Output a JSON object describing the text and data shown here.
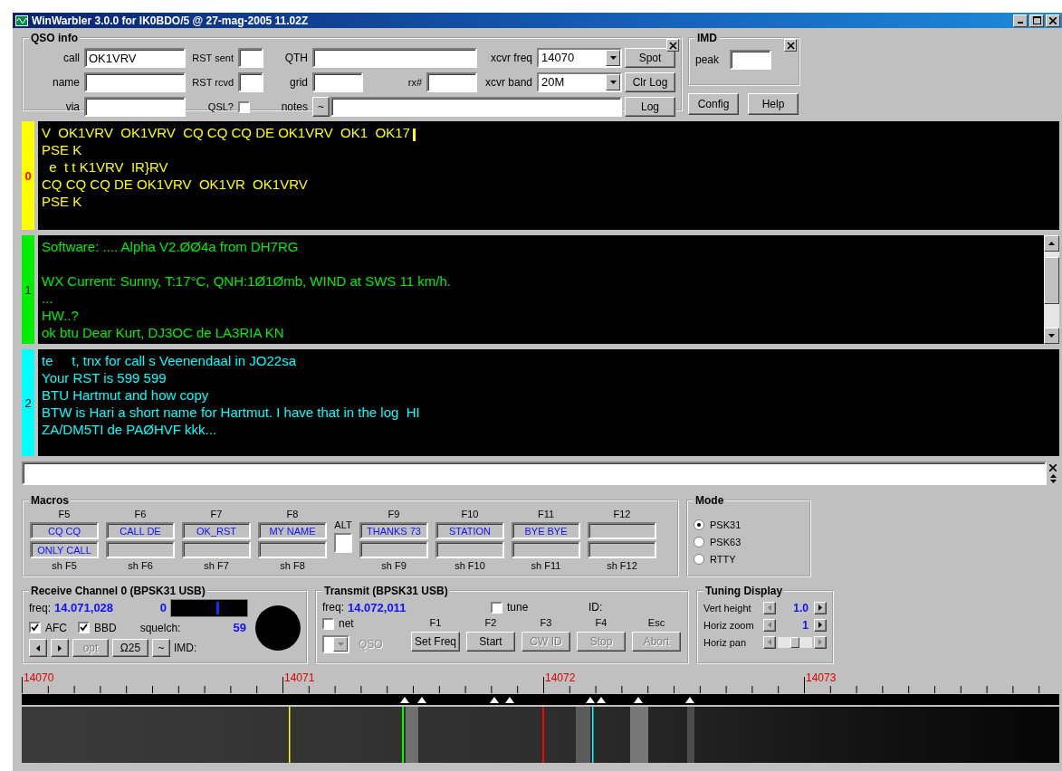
{
  "window": {
    "title": "WinWarbler 3.0.0 for IK0BDO/5 @ 27-mag-2005  11.02Z"
  },
  "qso_info": {
    "title": "QSO info",
    "call_label": "call",
    "call_value": "OK1VRV",
    "name_label": "name",
    "via_label": "via",
    "rst_sent_label": "RST sent",
    "rst_rcvd_label": "RST rcvd",
    "qsl_label": "QSL?",
    "qsl_checked": false,
    "qth_label": "QTH",
    "grid_label": "grid",
    "rx_label": "rx#",
    "notes_label": "notes",
    "notes_button": "~",
    "freq_label": "xcvr freq",
    "freq_value": "14070",
    "band_label": "xcvr band",
    "band_value": "20M",
    "buttons": [
      "Spot",
      "Clr Log",
      "Log"
    ]
  },
  "imd": {
    "title": "IMD",
    "peak_label": "peak"
  },
  "side_buttons": [
    "Config",
    "Help"
  ],
  "channels": [
    {
      "number": "0",
      "selected": true,
      "color": "#ffff00",
      "scrollable": false,
      "lines": [
        {
          "text": "V  OK1VRV  OK1VRV  CQ CQ CQ DE OK1VRV  OK1  OK17",
          "gap_before": false
        },
        {
          "text": "PSE K",
          "gap_before": false
        },
        {
          "text": "  e  t t K1VRV  IR}RV",
          "gap_before": false
        },
        {
          "text": "CQ CQ CQ DE OK1VRV  OK1VR  OK1VRV",
          "gap_before": false
        },
        {
          "text": "PSE K",
          "gap_before": false
        }
      ]
    },
    {
      "number": "1",
      "selected": false,
      "color": "#00ee00",
      "scrollable": true,
      "lines": [
        {
          "text": "Software: .... Alpha V2.ØØ4a from DH7RG",
          "gap_before": false
        },
        {
          "text": "WX Current: Sunny, T:17°C, QNH:1Ø1Ømb, WIND at SWS 11 km/h.",
          "gap_before": true
        },
        {
          "text": "...",
          "gap_before": false
        },
        {
          "text": "HW..?",
          "gap_before": false
        },
        {
          "text": "ok btu Dear Kurt, DJ3OC de LA3RIA KN",
          "gap_before": false
        }
      ]
    },
    {
      "number": "2",
      "selected": false,
      "color": "#00ffff",
      "scrollable": false,
      "lines": [
        {
          "text": "te     t, tnx for call s Veenendaal in JO22sa",
          "gap_before": false
        },
        {
          "text": "Your RST is 599 599",
          "gap_before": false
        },
        {
          "text": "BTU Hartmut and how copy",
          "gap_before": false
        },
        {
          "text": "BTW is Hari a short name for Hartmut. I have that in the log  HI",
          "gap_before": false
        },
        {
          "text": "ZA/DM5TI de PAØHVF kkk...",
          "gap_before": false
        }
      ]
    }
  ],
  "macros": {
    "title": "Macros",
    "alt": {
      "label": "ALT",
      "checked": false
    },
    "left": [
      {
        "key": "F5",
        "top": "CQ CQ",
        "bottom": "ONLY CALL",
        "shift": "sh F5"
      },
      {
        "key": "F6",
        "top": "CALL DE",
        "shift": "sh F6"
      },
      {
        "key": "F7",
        "top": "OK_RST",
        "shift": "sh F7"
      },
      {
        "key": "F8",
        "top": "MY NAME",
        "shift": "sh F8"
      }
    ],
    "right": [
      {
        "key": "F9",
        "top": "THANKS 73",
        "shift": "sh F9"
      },
      {
        "key": "F10",
        "top": "STATION",
        "shift": "sh F10"
      },
      {
        "key": "F11",
        "top": "BYE BYE",
        "shift": "sh F11"
      },
      {
        "key": "F12",
        "shift": "sh F12"
      }
    ]
  },
  "mode": {
    "title": "Mode",
    "options": [
      {
        "label": "PSK31",
        "selected": true
      },
      {
        "label": "PSK63",
        "selected": false
      },
      {
        "label": "RTTY",
        "selected": false
      }
    ]
  },
  "receive": {
    "title": "Receive Channel 0 (BPSK31 USB)",
    "freq_label": "freq:",
    "freq_value": "14.071,028",
    "channel": "0",
    "level": 0.6,
    "squelch_label": "squelch:",
    "squelch_value": "59",
    "checks": [
      {
        "label": "AFC",
        "checked": true
      },
      {
        "label": "BBD",
        "checked": true
      }
    ],
    "buttons": [
      {
        "label": "opt",
        "disabled": true
      },
      {
        "label": "Ω25",
        "disabled": false
      },
      {
        "label": "~",
        "disabled": false
      }
    ],
    "imd_label": "IMD:"
  },
  "transmit": {
    "title": "Transmit (BPSK31 USB)",
    "freq_label": "freq:",
    "freq_value": "14.072,011",
    "tune": {
      "label": "tune",
      "checked": false
    },
    "id_label": "ID:",
    "net": {
      "label": "net",
      "checked": false
    },
    "qso_label": "QSO",
    "qso_disabled": true,
    "keys": [
      {
        "key": "F1",
        "label": "Set Freq",
        "disabled": false
      },
      {
        "key": "F2",
        "label": "Start",
        "disabled": false
      },
      {
        "key": "F3",
        "label": "CW ID",
        "disabled": true
      },
      {
        "key": "F4",
        "label": "Stop",
        "disabled": true
      },
      {
        "key": "Esc",
        "label": "Abort",
        "disabled": true
      }
    ]
  },
  "tuning": {
    "title": "Tuning Display",
    "rows": [
      {
        "kind": "stepper",
        "label": "Vert height",
        "value": "1.0"
      },
      {
        "kind": "stepper",
        "label": "Horiz zoom",
        "value": "1"
      },
      {
        "kind": "slider",
        "label": "Horiz pan",
        "level": 0.5
      }
    ]
  },
  "spectrum": {
    "scale_labels": [
      "14070",
      "14071",
      "14072",
      "14073"
    ]
  }
}
